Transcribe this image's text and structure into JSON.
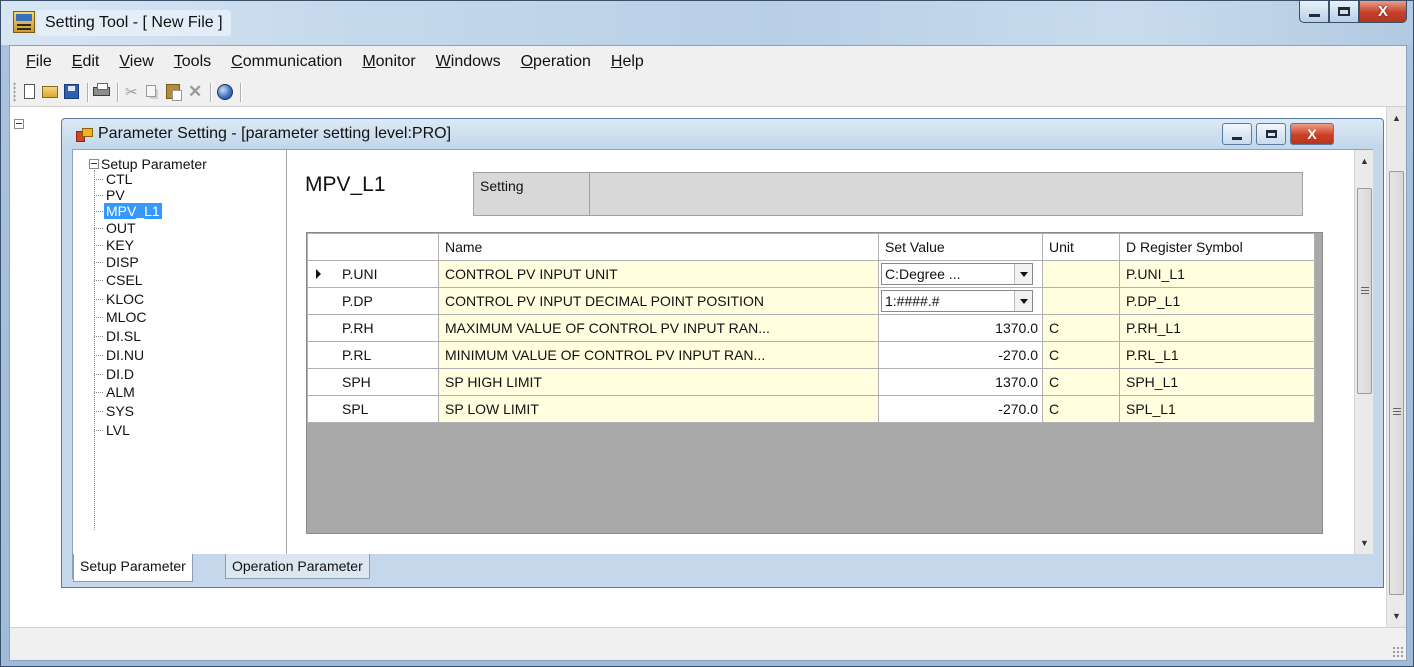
{
  "window": {
    "title": "Setting Tool - [ New File ]"
  },
  "menu": {
    "items": [
      {
        "mnemonic": "F",
        "rest": "ile"
      },
      {
        "mnemonic": "E",
        "rest": "dit"
      },
      {
        "mnemonic": "V",
        "rest": "iew"
      },
      {
        "mnemonic": "T",
        "rest": "ools"
      },
      {
        "mnemonic": "C",
        "rest": "ommunication"
      },
      {
        "mnemonic": "M",
        "rest": "onitor"
      },
      {
        "mnemonic": "W",
        "rest": "indows"
      },
      {
        "mnemonic": "O",
        "rest": "peration"
      },
      {
        "mnemonic": "H",
        "rest": "elp"
      }
    ]
  },
  "toolbar": {
    "icons": [
      "new-file-icon",
      "open-folder-icon",
      "save-icon",
      "print-icon",
      "cut-icon",
      "copy-icon",
      "paste-icon",
      "delete-icon",
      "help-icon"
    ]
  },
  "child": {
    "title": "Parameter Setting - [parameter setting level:PRO]"
  },
  "tree": {
    "root": "Setup Parameter",
    "items": [
      "CTL",
      "PV",
      "MPV_L1",
      "OUT",
      "KEY",
      "DISP",
      "CSEL",
      "KLOC",
      "MLOC",
      "DI.SL",
      "DI.NU",
      "DI.D",
      "ALM",
      "SYS",
      "LVL"
    ],
    "selected": "MPV_L1"
  },
  "content": {
    "heading": "MPV_L1",
    "setting_label": "Setting"
  },
  "grid": {
    "headers": {
      "name": "Name",
      "set_value": "Set Value",
      "unit": "Unit",
      "register": "D Register Symbol"
    },
    "rows": [
      {
        "param": "P.UNI",
        "name": "CONTROL PV INPUT UNIT",
        "value": "C:Degree ...",
        "unit": "",
        "register": "P.UNI_L1",
        "type": "combo",
        "current": true
      },
      {
        "param": "P.DP",
        "name": "CONTROL PV INPUT DECIMAL POINT POSITION",
        "value": "1:####.#",
        "unit": "",
        "register": "P.DP_L1",
        "type": "combo",
        "current": false
      },
      {
        "param": "P.RH",
        "name": "MAXIMUM VALUE OF CONTROL PV INPUT RAN...",
        "value": "1370.0",
        "unit": "C",
        "register": "P.RH_L1",
        "type": "text",
        "current": false
      },
      {
        "param": "P.RL",
        "name": "MINIMUM VALUE OF CONTROL PV INPUT RAN...",
        "value": "-270.0",
        "unit": "C",
        "register": "P.RL_L1",
        "type": "text",
        "current": false
      },
      {
        "param": "SPH",
        "name": "SP HIGH LIMIT",
        "value": "1370.0",
        "unit": "C",
        "register": "SPH_L1",
        "type": "text",
        "current": false
      },
      {
        "param": "SPL",
        "name": "SP LOW LIMIT",
        "value": "-270.0",
        "unit": "C",
        "register": "SPL_L1",
        "type": "text",
        "current": false
      }
    ]
  },
  "tabs": {
    "items": [
      "Setup Parameter",
      "Operation Parameter"
    ],
    "active": "Setup Parameter"
  },
  "colors": {
    "selection": "#3399ff",
    "readonly_cell": "#ffffe0",
    "grid_background": "#a8a8a8"
  }
}
